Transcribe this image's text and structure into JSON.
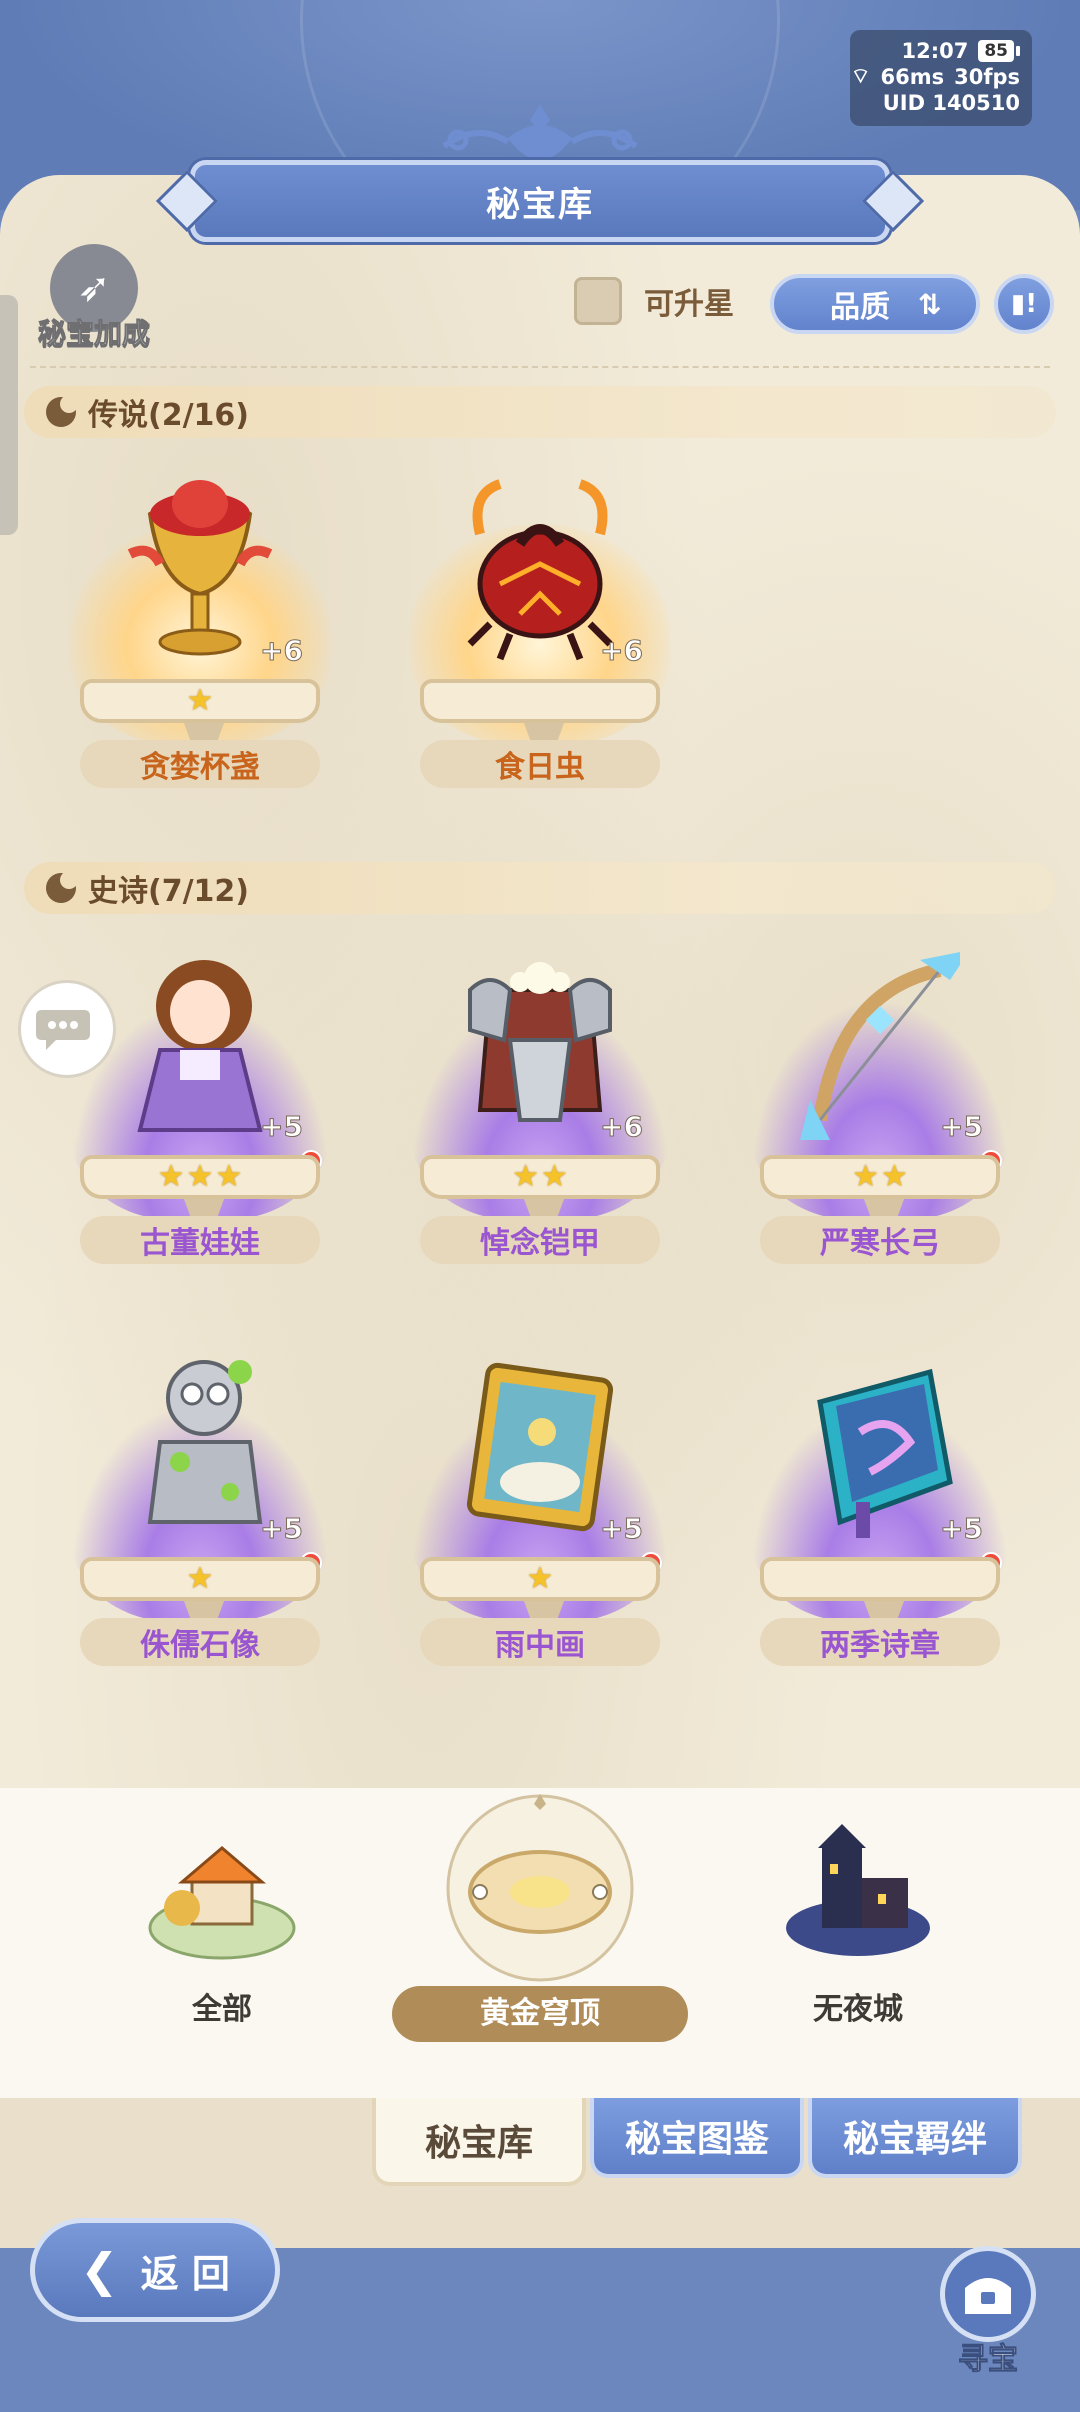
{
  "status": {
    "time": "12:07",
    "battery": "85",
    "ping": "66ms",
    "fps": "30fps",
    "uid": "UID 140510"
  },
  "header": {
    "title": "秘宝库"
  },
  "toolbar": {
    "bonus_label": "秘宝加成",
    "upgradable_label": "可升星",
    "sort_label": "品质"
  },
  "sections": {
    "legend": {
      "title": "传说(2/16)"
    },
    "epic": {
      "title": "史诗(7/12)"
    }
  },
  "legend_items": [
    {
      "name": "贪婪杯盏",
      "level": "+6",
      "stars": 1
    },
    {
      "name": "食日虫",
      "level": "+6",
      "stars": 0
    }
  ],
  "epic_items": [
    {
      "name": "古董娃娃",
      "level": "+5",
      "stars": 3,
      "alert": true
    },
    {
      "name": "悼念铠甲",
      "level": "+6",
      "stars": 2,
      "alert": false
    },
    {
      "name": "严寒长弓",
      "level": "+5",
      "stars": 2,
      "alert": true
    },
    {
      "name": "侏儒石像",
      "level": "+5",
      "stars": 1,
      "alert": true
    },
    {
      "name": "雨中画",
      "level": "+5",
      "stars": 1,
      "alert": true
    },
    {
      "name": "两季诗章",
      "level": "+5",
      "stars": 0,
      "alert": true
    }
  ],
  "regions": [
    {
      "label": "全部"
    },
    {
      "label": "黄金穹顶",
      "active": true
    },
    {
      "label": "无夜城"
    }
  ],
  "tabs": [
    {
      "label": "秘宝库",
      "active": true
    },
    {
      "label": "秘宝图鉴"
    },
    {
      "label": "秘宝羁绊"
    }
  ],
  "footer": {
    "back_label": "返 回",
    "hunt_label": "寻宝"
  },
  "colors": {
    "accent": "#6283cd",
    "legend": "#c8641c",
    "epic": "#9a56d0",
    "alert": "#ef4b3c"
  }
}
